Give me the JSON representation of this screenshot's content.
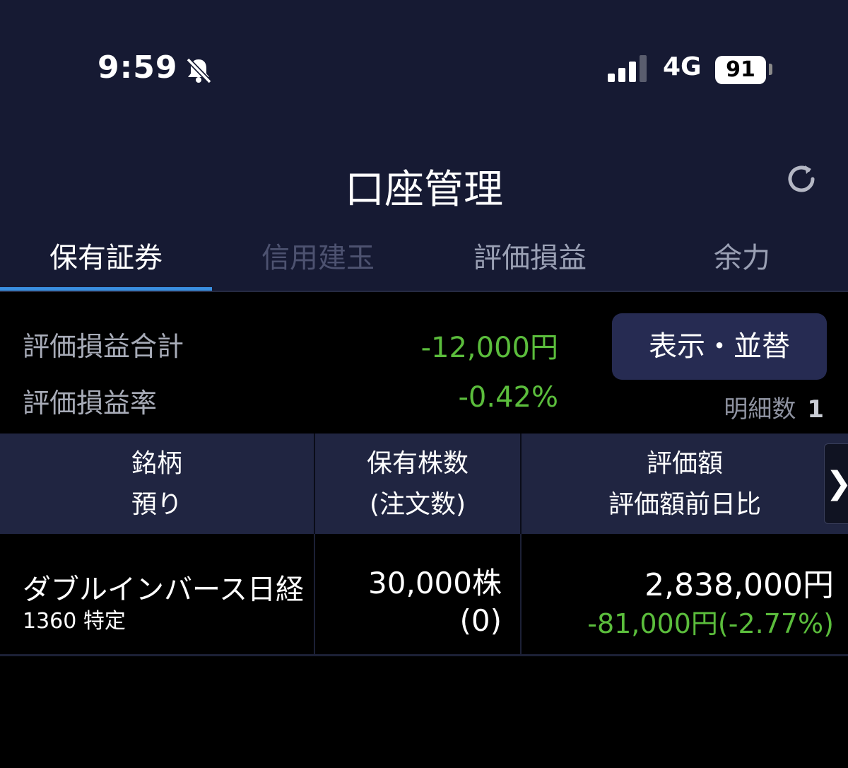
{
  "status_bar": {
    "time": "9:59",
    "network": "4G",
    "battery": "91"
  },
  "header": {
    "title": "口座管理"
  },
  "tabs": [
    {
      "label": "保有証券",
      "state": "active"
    },
    {
      "label": "信用建玉",
      "state": "disabled"
    },
    {
      "label": "評価損益",
      "state": "normal"
    },
    {
      "label": "余力",
      "state": "normal"
    }
  ],
  "summary": {
    "pl_total_label": "評価損益合計",
    "pl_total_value": "-12,000円",
    "pl_rate_label": "評価損益率",
    "pl_rate_value": "-0.42%",
    "sort_button": "表示・並替",
    "detail_count_label": "明細数",
    "detail_count": "1"
  },
  "table": {
    "headers": [
      {
        "line1": "銘柄",
        "line2": "預り"
      },
      {
        "line1": "保有株数",
        "line2": "(注文数)"
      },
      {
        "line1": "評価額",
        "line2": "評価額前日比"
      }
    ],
    "next_icon": "chevron-right-icon",
    "rows": [
      {
        "name": "ダブルインバース日経",
        "code_account": "1360 特定",
        "shares": "30,000株",
        "orders": "(0)",
        "value": "2,838,000円",
        "change": "-81,000円(-2.77%)"
      }
    ]
  },
  "colors": {
    "header_bg": "#161a33",
    "accent": "#3a8fe0",
    "negative": "#5bbd3c",
    "button_bg": "#262b52"
  }
}
